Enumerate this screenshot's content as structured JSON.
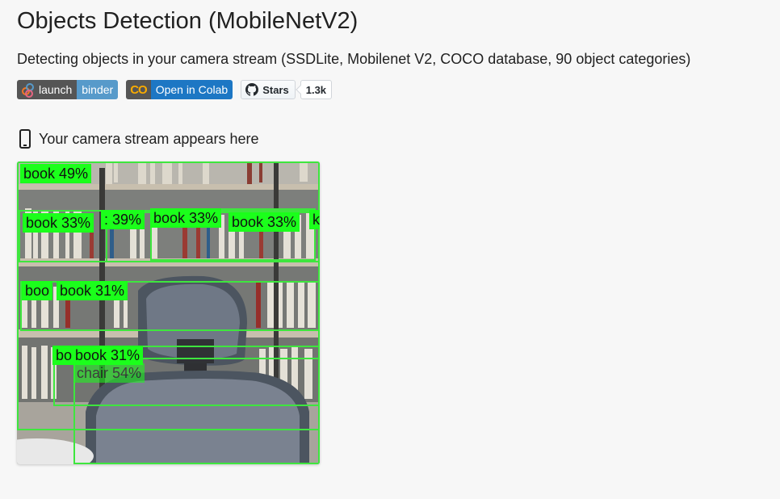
{
  "page": {
    "title": "Objects Detection (MobileNetV2)",
    "subtitle": "Detecting objects in your camera stream (SSDLite, Mobilenet V2, COCO database, 90 object categories)"
  },
  "badges": {
    "binder_left": "launch",
    "binder_right": "binder",
    "colab_left": "CO",
    "colab_right": "Open in Colab",
    "github_label": "Stars",
    "github_count": "1.3k"
  },
  "camera": {
    "label": "Your camera stream appears here",
    "icon": "phone-icon",
    "detections": [
      {
        "label": "book 49%"
      },
      {
        "label": "book 33%"
      },
      {
        "label": ": 39%"
      },
      {
        "label": "book 33%"
      },
      {
        "label": "book 33%"
      },
      {
        "label": "k"
      },
      {
        "label": "boo"
      },
      {
        "label": "book 31%"
      },
      {
        "label": "bo"
      },
      {
        "label": "book 31%"
      },
      {
        "label": "chair 54%"
      }
    ]
  },
  "colors": {
    "box_stroke": "#3ee63e",
    "label_bg": "#1bff1b",
    "page_bg": "#f7f7f7"
  }
}
